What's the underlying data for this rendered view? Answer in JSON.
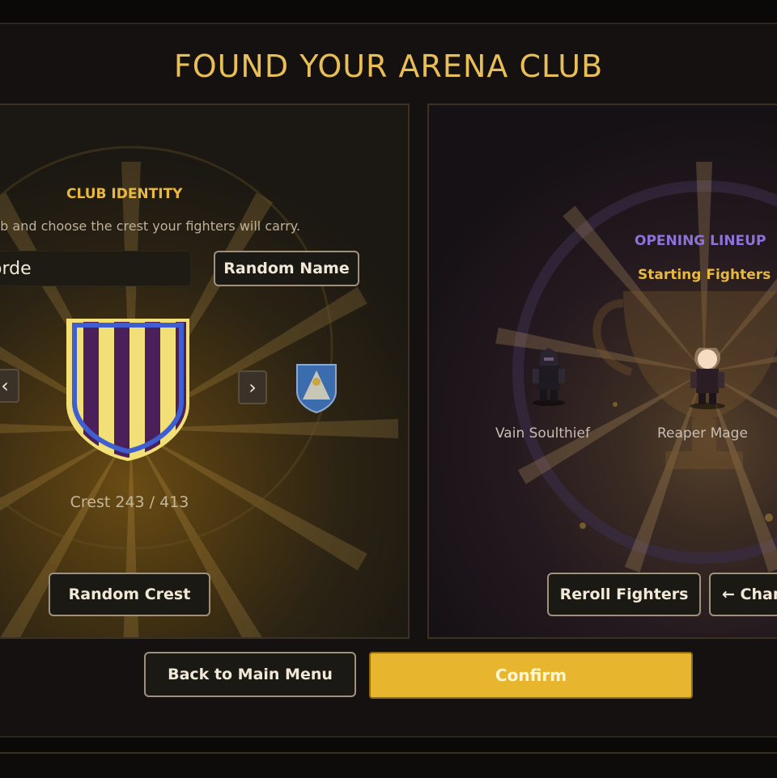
{
  "title": "FOUND YOUR ARENA CLUB",
  "identity": {
    "heading": "CLUB IDENTITY",
    "hint": "ub and choose the crest your fighters will carry.",
    "name_value": "orde",
    "random_name_label": "Random Name",
    "crest_counter": "Crest 243 / 413",
    "random_crest_label": "Random Crest",
    "prev_glyph": "‹",
    "next_glyph": "›",
    "crest_colors": {
      "stripe_a": "#f3df78",
      "stripe_b": "#4a1f5a",
      "outline": "#3d5fd2"
    }
  },
  "lineup": {
    "heading": "OPENING LINEUP",
    "subheading": "Starting Fighters",
    "fighters": [
      {
        "name": "Vain Soulthief"
      },
      {
        "name": "Reaper Mage"
      }
    ],
    "reroll_label": "Reroll Fighters",
    "change_label": "← Chan"
  },
  "footer": {
    "back_label": "Back to Main Menu",
    "confirm_label": "Confirm"
  },
  "colors": {
    "accent_gold": "#e8be57",
    "lineup_purple": "#8e72d8",
    "confirm_fill": "#e8b62e"
  }
}
